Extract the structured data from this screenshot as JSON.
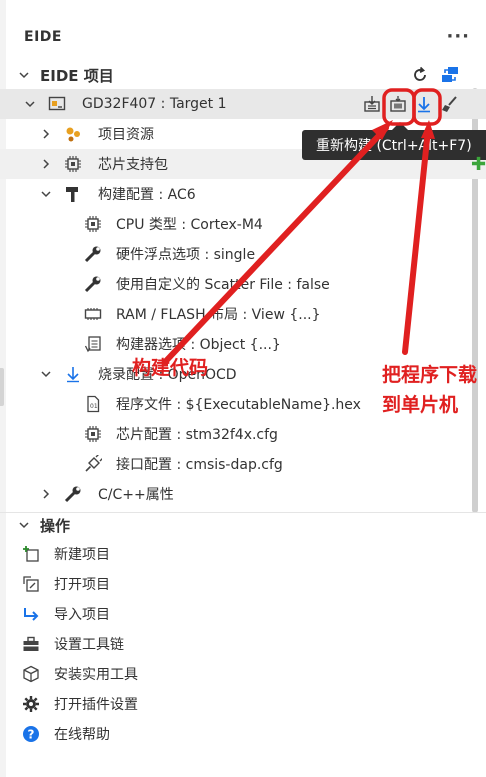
{
  "panel": {
    "title": "EIDE",
    "more_label": "···"
  },
  "project_section": {
    "label": "EIDE 项目"
  },
  "target": {
    "label": "GD32F407 : Target 1"
  },
  "tree": [
    {
      "label": "项目资源"
    },
    {
      "label": "芯片支持包"
    },
    {
      "label": "构建配置 : AC6"
    },
    {
      "label": "CPU 类型 : Cortex-M4"
    },
    {
      "label": "硬件浮点选项 : single"
    },
    {
      "label": "使用自定义的 Scatter File : false"
    },
    {
      "label": "RAM / FLASH 布局 : View {...}"
    },
    {
      "label": "构建器选项 : Object {...}"
    },
    {
      "label": "烧录配置 : OpenOCD"
    },
    {
      "label": "程序文件 : ${ExecutableName}.hex"
    },
    {
      "label": "芯片配置 : stm32f4x.cfg"
    },
    {
      "label": "接口配置 : cmsis-dap.cfg"
    },
    {
      "label": "C/C++属性"
    }
  ],
  "tooltip": {
    "text": "重新构建 (Ctrl+Alt+F7)"
  },
  "operations_section": {
    "label": "操作"
  },
  "operations": [
    {
      "label": "新建项目"
    },
    {
      "label": "打开项目"
    },
    {
      "label": "导入项目"
    },
    {
      "label": "设置工具链"
    },
    {
      "label": "安装实用工具"
    },
    {
      "label": "打开插件设置"
    },
    {
      "label": "在线帮助"
    }
  ],
  "annotations": {
    "build_code": "构建代码",
    "download": "把程序下载到单片机"
  },
  "colors": {
    "accent_blue": "#1a73e8",
    "annotation_red": "#e02020",
    "tooltip_bg": "#2f2f2f",
    "selected_bg": "#e8e8e8"
  },
  "icons": {
    "build": "build-icon",
    "rebuild": "rebuild-icon",
    "download": "download-icon",
    "clean": "broom-icon",
    "refresh": "refresh-icon",
    "workspace": "workspace-icon",
    "chip": "chip-icon",
    "wrench": "wrench-icon",
    "hammer": "hammer-icon",
    "file": "file-icon",
    "plug": "plug-icon",
    "help": "help-icon",
    "gear": "gear-icon"
  }
}
